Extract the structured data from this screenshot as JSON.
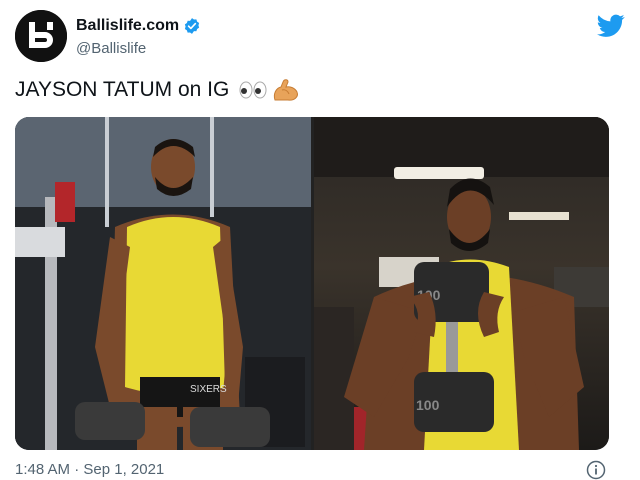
{
  "tweet": {
    "author_name": "Ballislife.com",
    "author_handle": "@Ballislife",
    "text": "JAYSON TATUM on IG",
    "emojis": [
      "eyes-emoji",
      "flexed-biceps-emoji"
    ],
    "timestamp": "1:48 AM · Sep 1, 2021"
  },
  "media": {
    "left_photo_text": "SIXERS",
    "right_photo_dumbbell_top": "100",
    "right_photo_dumbbell_bottom": "100"
  },
  "colors": {
    "verified": "#1d9bf0",
    "twitter_brand": "#1d9bf0",
    "jersey_yellow": "#e8d934"
  },
  "icons": [
    "ballislife-logo-icon",
    "verified-badge-icon",
    "twitter-bird-icon",
    "info-icon"
  ]
}
